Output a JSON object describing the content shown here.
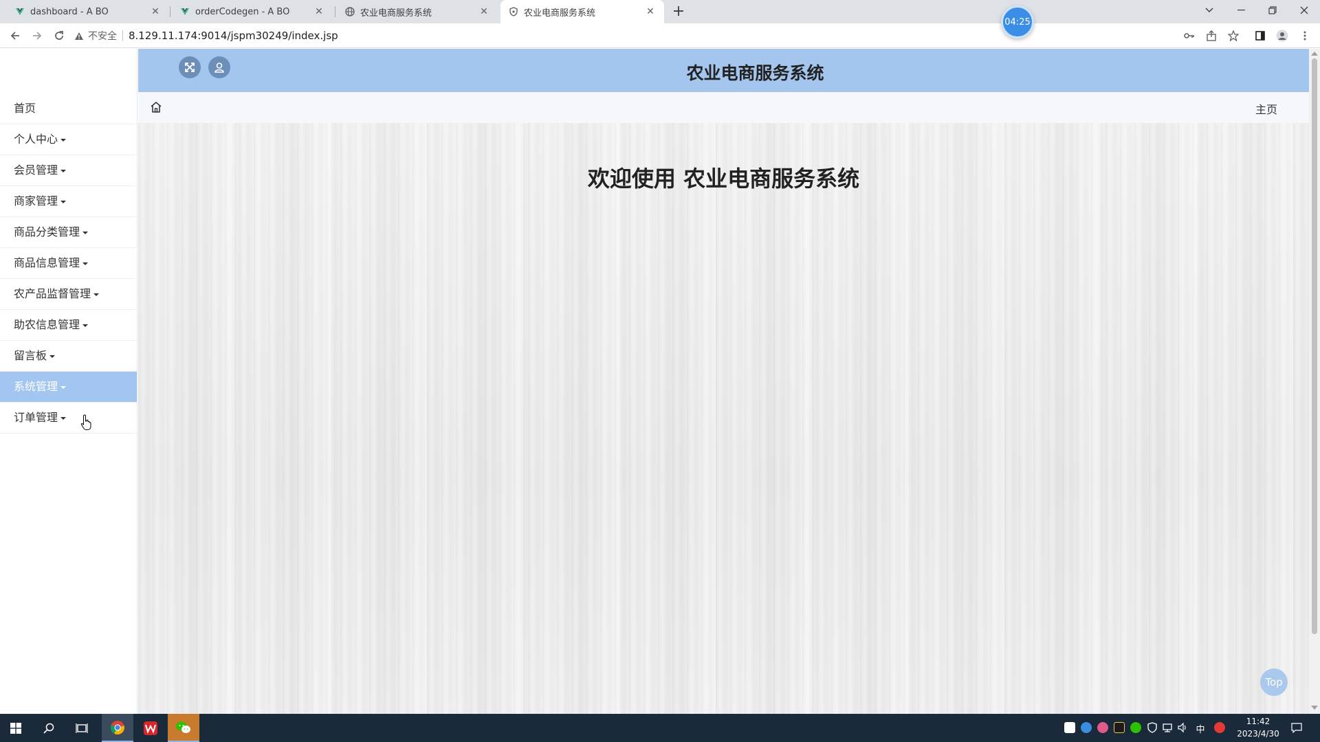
{
  "browser": {
    "tabs": [
      {
        "title": "dashboard - A BO"
      },
      {
        "title": "orderCodegen - A BO"
      },
      {
        "title": "农业电商服务系统"
      },
      {
        "title": "农业电商服务系统"
      }
    ],
    "new_tab_label": "+",
    "address": {
      "insecure_label": "不安全",
      "url": "8.129.11.174:9014/jspm30249/index.jsp"
    },
    "timer": "04:25"
  },
  "header": {
    "title": "农业电商服务系统"
  },
  "breadcrumb": {
    "current": "主页"
  },
  "sidebar": {
    "items": [
      {
        "label": "首页",
        "dropdown": false
      },
      {
        "label": "个人中心",
        "dropdown": true
      },
      {
        "label": "会员管理",
        "dropdown": true
      },
      {
        "label": "商家管理",
        "dropdown": true
      },
      {
        "label": "商品分类管理",
        "dropdown": true
      },
      {
        "label": "商品信息管理",
        "dropdown": true
      },
      {
        "label": "农产品监督管理",
        "dropdown": true
      },
      {
        "label": "助农信息管理",
        "dropdown": true
      },
      {
        "label": "留言板",
        "dropdown": true
      },
      {
        "label": "系统管理",
        "dropdown": true,
        "active": true
      },
      {
        "label": "订单管理",
        "dropdown": true
      }
    ]
  },
  "main": {
    "welcome": "欢迎使用 农业电商服务系统",
    "top_button": "Top"
  },
  "taskbar": {
    "time": "11:42",
    "date": "2023/4/30",
    "ime": "中"
  },
  "colors": {
    "header_bg": "#a3c5ee",
    "active_menu_bg": "#a2c6ef",
    "breadcrumb_bg": "#f4f8fd",
    "taskbar_bg": "#1b2a3a"
  }
}
